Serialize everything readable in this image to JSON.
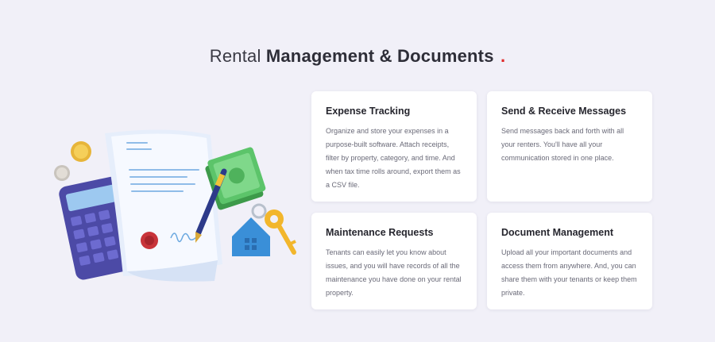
{
  "section": {
    "title_light": "Rental",
    "title_bold": "Management & Documents",
    "title_dot": "."
  },
  "colors": {
    "accent_dot": "#e02a2a",
    "background": "#f1f0f8",
    "card_bg": "#ffffff"
  },
  "illustration": {
    "icons": [
      "calculator-icon",
      "document-icon",
      "pen-icon",
      "money-icon",
      "house-keychain-icon",
      "key-icon",
      "coin-icon",
      "wax-seal-icon"
    ]
  },
  "cards": [
    {
      "title": "Expense Tracking",
      "body": "Organize and store your expenses in a purpose-built software. Attach receipts, filter by property, category, and time. And when tax time rolls around, export them as a CSV file."
    },
    {
      "title": "Send & Receive Messages",
      "body": "Send messages back and forth with all your renters. You'll have all your communication stored in one place."
    },
    {
      "title": "Maintenance Requests",
      "body": "Tenants can easily let you know about issues, and you will have records of all the maintenance you have done on your rental property."
    },
    {
      "title": "Document Management",
      "body": "Upload all your important documents and access them from anywhere. And, you can share them with your tenants or keep them private."
    }
  ]
}
